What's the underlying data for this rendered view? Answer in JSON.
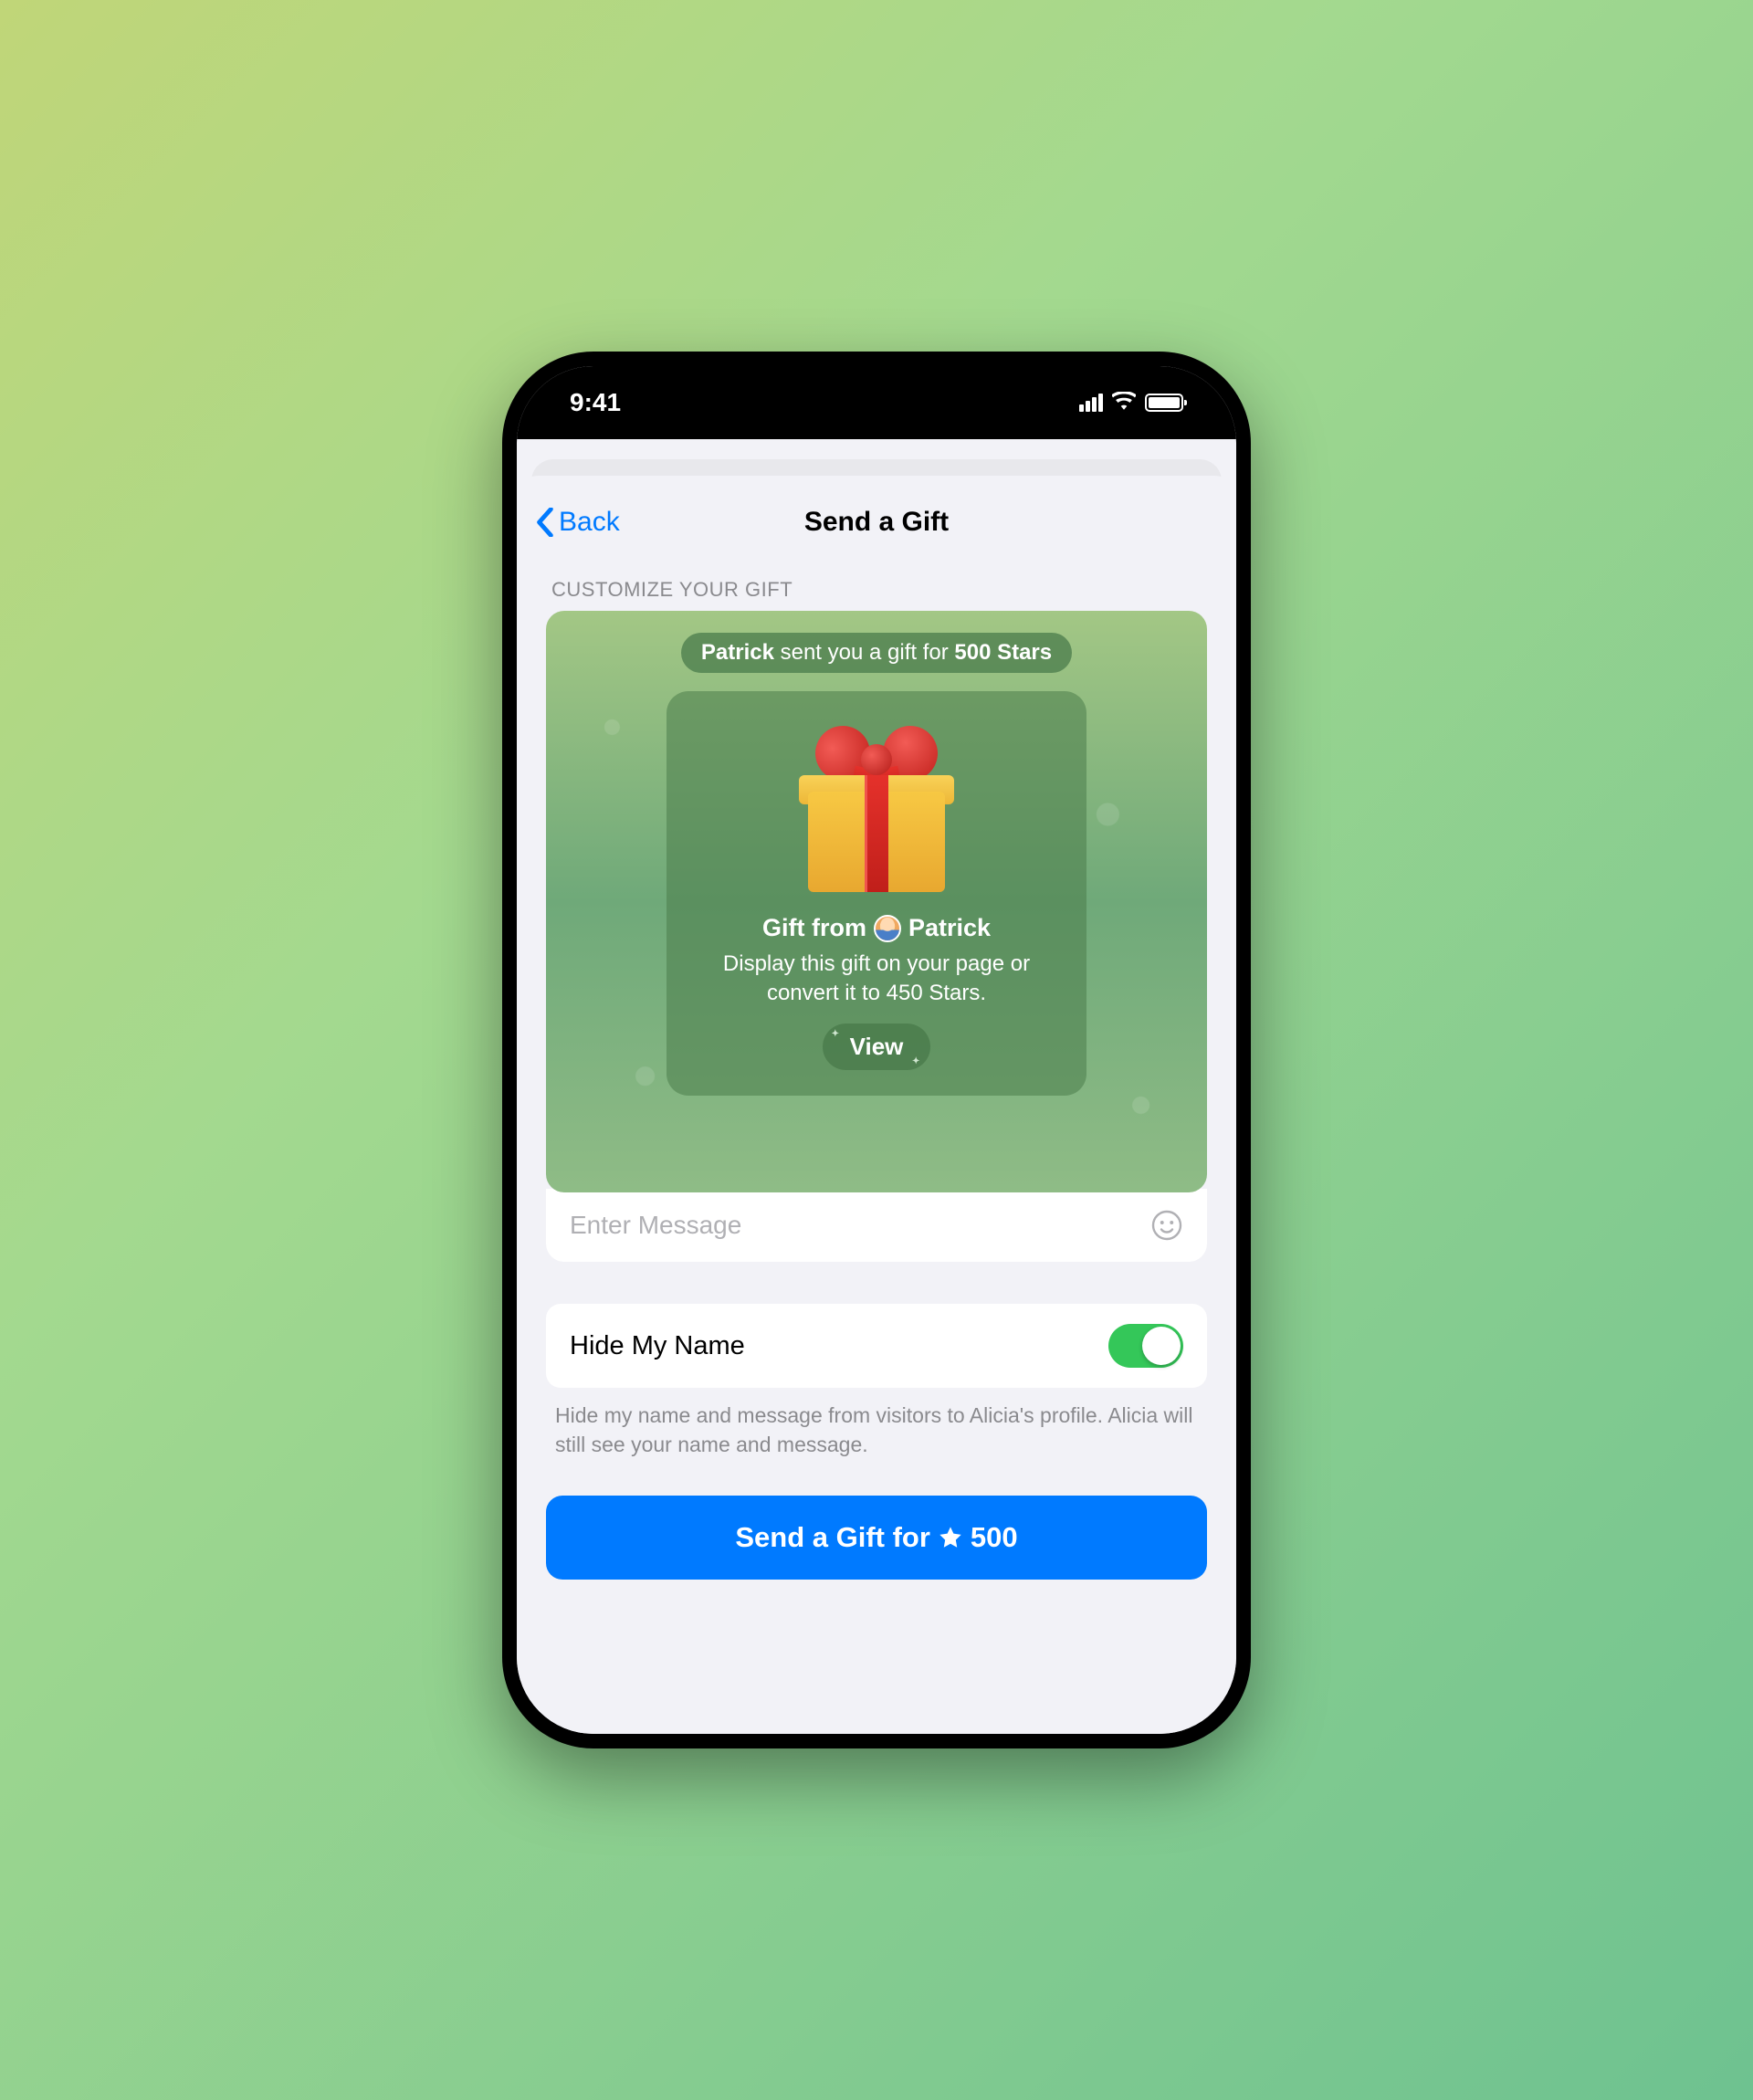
{
  "status": {
    "time": "9:41"
  },
  "nav": {
    "back_label": "Back",
    "title": "Send a Gift"
  },
  "section_header": "CUSTOMIZE YOUR GIFT",
  "preview": {
    "pill_name": "Patrick",
    "pill_mid": " sent you a gift for ",
    "pill_cost": "500 Stars",
    "gift_from_prefix": "Gift from ",
    "gift_from_name": "Patrick",
    "description": "Display this gift on your page or convert it to 450 Stars.",
    "view_label": "View"
  },
  "message": {
    "placeholder": "Enter Message"
  },
  "hide_name": {
    "label": "Hide My Name",
    "enabled": true,
    "description": "Hide my name and message from visitors to Alicia's profile. Alicia will still see your name and message."
  },
  "send_button": {
    "prefix": "Send a Gift for ",
    "amount": "500"
  }
}
